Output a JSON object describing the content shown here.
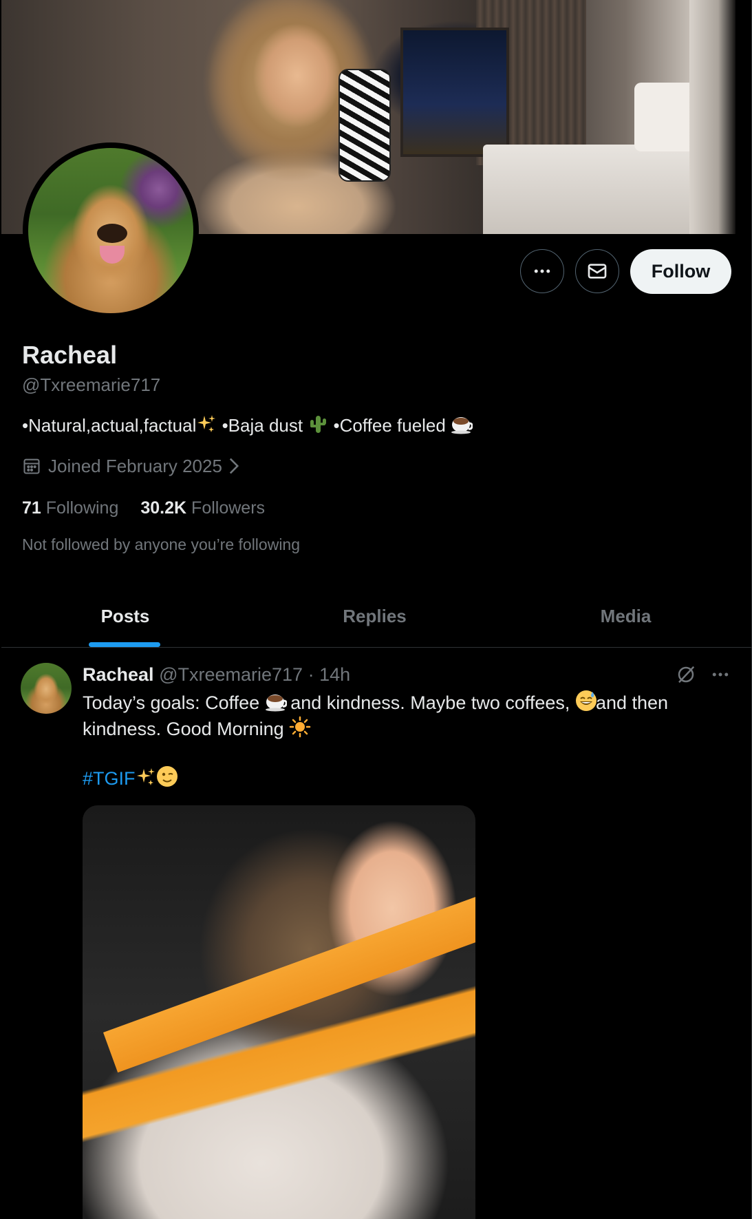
{
  "profile": {
    "name": "Racheal",
    "handle": "@Txreemarie717",
    "bio_part1": "•Natural,actual,factual",
    "bio_part2": " •Baja dust ",
    "bio_part3": " •Coffee fueled ",
    "joined": "Joined February 2025",
    "following_count": "71",
    "following_label": "Following",
    "followers_count": "30.2K",
    "followers_label": "Followers",
    "not_followed_text": "Not followed by anyone you’re following"
  },
  "actions": {
    "follow_label": "Follow",
    "more_icon": "more-horizontal-icon",
    "message_icon": "mail-icon"
  },
  "tabs": [
    {
      "label": "Posts",
      "active": true
    },
    {
      "label": "Replies",
      "active": false
    },
    {
      "label": "Media",
      "active": false
    }
  ],
  "post": {
    "author_name": "Racheal",
    "author_handle": "@Txreemarie717",
    "separator": " · ",
    "time": "14h",
    "text_part1": "Today’s goals: Coffee ",
    "text_part2": " and kindness. Maybe two coffees, ",
    "text_part3": "and then kindness. Good Morning ",
    "hashtag": "#TGIF",
    "icons": [
      "grok-icon",
      "more-horizontal-icon"
    ]
  },
  "colors": {
    "background": "#000000",
    "text_primary": "#e7e9ea",
    "text_secondary": "#71767b",
    "accent": "#1d9bf0",
    "follow_button_bg": "#eff3f4",
    "border": "#2f3336"
  }
}
